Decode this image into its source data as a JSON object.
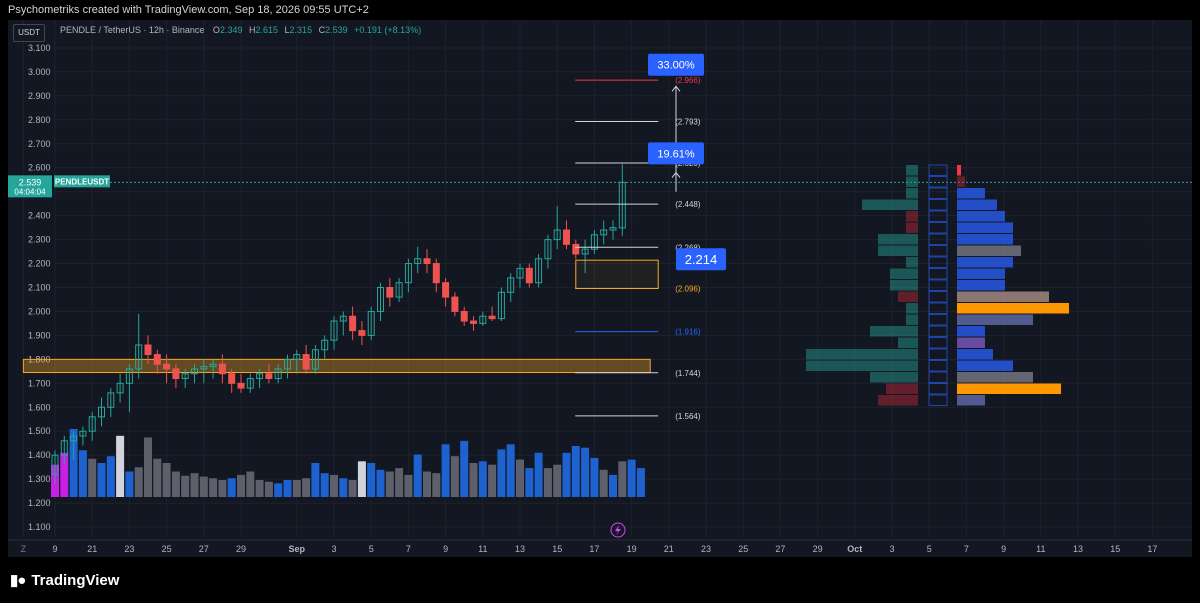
{
  "header": {
    "title": "Psychometriks created with TradingView.com, Sep 18, 2026 09:55 UTC+2"
  },
  "legend": {
    "symbol": "PENDLE / TetherUS · 12h · Binance",
    "open_label": "O",
    "open": "2.349",
    "high_label": "H",
    "high": "2.615",
    "low_label": "L",
    "low": "2.315",
    "close_label": "C",
    "close": "2.539",
    "change": "+0.191 (+8.13%)"
  },
  "currency_label": "USDT",
  "price_tag": {
    "price": "2.539",
    "countdown": "04:04:04",
    "ticker": "PENDLEUSDT"
  },
  "footer": {
    "logo_text": "TradingView"
  },
  "colors": {
    "up": "#26a69a",
    "down": "#ef5350",
    "grid": "#1e222d",
    "text": "#b2b5be",
    "volume_blue": "#1e62d0",
    "volume_gray": "#5d606b",
    "volume_white": "#d1d4dc",
    "volume_magenta": "#c81ee6",
    "zone_orange": "#f9a825",
    "label_blue": "#2962ff"
  },
  "chart_data": {
    "type": "candlestick",
    "y_ticks": [
      "3.100",
      "3.000",
      "2.900",
      "2.800",
      "2.700",
      "2.600",
      "2.500",
      "2.400",
      "2.300",
      "2.200",
      "2.100",
      "2.000",
      "1.900",
      "1.800",
      "1.700",
      "1.600",
      "1.500",
      "1.400",
      "1.300",
      "1.200",
      "1.100"
    ],
    "ylim": [
      1.05,
      3.15
    ],
    "x_ticks": [
      {
        "label": "Z",
        "day": 17.3
      },
      {
        "label": "9",
        "day": 19
      },
      {
        "label": "21",
        "day": 21
      },
      {
        "label": "23",
        "day": 23
      },
      {
        "label": "25",
        "day": 25
      },
      {
        "label": "27",
        "day": 27
      },
      {
        "label": "29",
        "day": 29
      },
      {
        "label": "Sep",
        "day": 32
      },
      {
        "label": "3",
        "day": 34
      },
      {
        "label": "5",
        "day": 36
      },
      {
        "label": "7",
        "day": 38
      },
      {
        "label": "9",
        "day": 40
      },
      {
        "label": "11",
        "day": 42
      },
      {
        "label": "13",
        "day": 44
      },
      {
        "label": "15",
        "day": 46
      },
      {
        "label": "17",
        "day": 48
      },
      {
        "label": "19",
        "day": 50
      },
      {
        "label": "21",
        "day": 52
      },
      {
        "label": "23",
        "day": 54
      },
      {
        "label": "25",
        "day": 56
      },
      {
        "label": "27",
        "day": 58
      },
      {
        "label": "29",
        "day": 60
      },
      {
        "label": "Oct",
        "day": 62
      },
      {
        "label": "3",
        "day": 64
      },
      {
        "label": "5",
        "day": 66
      },
      {
        "label": "7",
        "day": 68
      },
      {
        "label": "9",
        "day": 70
      },
      {
        "label": "11",
        "day": 72
      },
      {
        "label": "13",
        "day": 74
      },
      {
        "label": "15",
        "day": 76
      },
      {
        "label": "17",
        "day": 78
      }
    ],
    "candles": [
      {
        "t": 19.0,
        "o": 1.32,
        "h": 1.42,
        "l": 1.28,
        "c": 1.4
      },
      {
        "t": 19.5,
        "o": 1.4,
        "h": 1.48,
        "l": 1.36,
        "c": 1.46
      },
      {
        "t": 20.0,
        "o": 1.46,
        "h": 1.5,
        "l": 1.38,
        "c": 1.48
      },
      {
        "t": 20.5,
        "o": 1.48,
        "h": 1.52,
        "l": 1.44,
        "c": 1.5
      },
      {
        "t": 21.0,
        "o": 1.5,
        "h": 1.58,
        "l": 1.46,
        "c": 1.56
      },
      {
        "t": 21.5,
        "o": 1.56,
        "h": 1.64,
        "l": 1.52,
        "c": 1.6
      },
      {
        "t": 22.0,
        "o": 1.6,
        "h": 1.68,
        "l": 1.56,
        "c": 1.66
      },
      {
        "t": 22.5,
        "o": 1.66,
        "h": 1.74,
        "l": 1.62,
        "c": 1.7
      },
      {
        "t": 23.0,
        "o": 1.7,
        "h": 1.78,
        "l": 1.58,
        "c": 1.76
      },
      {
        "t": 23.5,
        "o": 1.76,
        "h": 1.99,
        "l": 1.72,
        "c": 1.86
      },
      {
        "t": 24.0,
        "o": 1.86,
        "h": 1.9,
        "l": 1.78,
        "c": 1.82
      },
      {
        "t": 24.5,
        "o": 1.82,
        "h": 1.84,
        "l": 1.74,
        "c": 1.78
      },
      {
        "t": 25.0,
        "o": 1.78,
        "h": 1.82,
        "l": 1.7,
        "c": 1.76
      },
      {
        "t": 25.5,
        "o": 1.76,
        "h": 1.78,
        "l": 1.68,
        "c": 1.72
      },
      {
        "t": 26.0,
        "o": 1.72,
        "h": 1.76,
        "l": 1.68,
        "c": 1.74
      },
      {
        "t": 26.5,
        "o": 1.74,
        "h": 1.78,
        "l": 1.7,
        "c": 1.76
      },
      {
        "t": 27.0,
        "o": 1.76,
        "h": 1.8,
        "l": 1.7,
        "c": 1.77
      },
      {
        "t": 27.5,
        "o": 1.77,
        "h": 1.8,
        "l": 1.72,
        "c": 1.78
      },
      {
        "t": 28.0,
        "o": 1.78,
        "h": 1.82,
        "l": 1.7,
        "c": 1.74
      },
      {
        "t": 28.5,
        "o": 1.74,
        "h": 1.76,
        "l": 1.66,
        "c": 1.7
      },
      {
        "t": 29.0,
        "o": 1.7,
        "h": 1.74,
        "l": 1.66,
        "c": 1.68
      },
      {
        "t": 29.5,
        "o": 1.68,
        "h": 1.74,
        "l": 1.66,
        "c": 1.72
      },
      {
        "t": 30.0,
        "o": 1.72,
        "h": 1.76,
        "l": 1.68,
        "c": 1.74
      },
      {
        "t": 30.5,
        "o": 1.74,
        "h": 1.78,
        "l": 1.7,
        "c": 1.72
      },
      {
        "t": 31.0,
        "o": 1.72,
        "h": 1.78,
        "l": 1.7,
        "c": 1.76
      },
      {
        "t": 31.5,
        "o": 1.76,
        "h": 1.82,
        "l": 1.72,
        "c": 1.8
      },
      {
        "t": 32.0,
        "o": 1.8,
        "h": 1.84,
        "l": 1.74,
        "c": 1.82
      },
      {
        "t": 32.5,
        "o": 1.82,
        "h": 1.86,
        "l": 1.74,
        "c": 1.76
      },
      {
        "t": 33.0,
        "o": 1.76,
        "h": 1.86,
        "l": 1.74,
        "c": 1.84
      },
      {
        "t": 33.5,
        "o": 1.84,
        "h": 1.9,
        "l": 1.8,
        "c": 1.88
      },
      {
        "t": 34.0,
        "o": 1.88,
        "h": 1.98,
        "l": 1.84,
        "c": 1.96
      },
      {
        "t": 34.5,
        "o": 1.96,
        "h": 2.0,
        "l": 1.9,
        "c": 1.98
      },
      {
        "t": 35.0,
        "o": 1.98,
        "h": 2.02,
        "l": 1.88,
        "c": 1.92
      },
      {
        "t": 35.5,
        "o": 1.92,
        "h": 1.96,
        "l": 1.86,
        "c": 1.9
      },
      {
        "t": 36.0,
        "o": 1.9,
        "h": 2.02,
        "l": 1.88,
        "c": 2.0
      },
      {
        "t": 36.5,
        "o": 2.0,
        "h": 2.12,
        "l": 1.96,
        "c": 2.1
      },
      {
        "t": 37.0,
        "o": 2.1,
        "h": 2.14,
        "l": 2.02,
        "c": 2.06
      },
      {
        "t": 37.5,
        "o": 2.06,
        "h": 2.14,
        "l": 2.04,
        "c": 2.12
      },
      {
        "t": 38.0,
        "o": 2.12,
        "h": 2.22,
        "l": 2.08,
        "c": 2.2
      },
      {
        "t": 38.5,
        "o": 2.2,
        "h": 2.27,
        "l": 2.16,
        "c": 2.22
      },
      {
        "t": 39.0,
        "o": 2.22,
        "h": 2.26,
        "l": 2.16,
        "c": 2.2
      },
      {
        "t": 39.5,
        "o": 2.2,
        "h": 2.22,
        "l": 2.08,
        "c": 2.12
      },
      {
        "t": 40.0,
        "o": 2.12,
        "h": 2.14,
        "l": 2.02,
        "c": 2.06
      },
      {
        "t": 40.5,
        "o": 2.06,
        "h": 2.08,
        "l": 1.98,
        "c": 2.0
      },
      {
        "t": 41.0,
        "o": 2.0,
        "h": 2.02,
        "l": 1.94,
        "c": 1.96
      },
      {
        "t": 41.5,
        "o": 1.96,
        "h": 1.98,
        "l": 1.92,
        "c": 1.95
      },
      {
        "t": 42.0,
        "o": 1.95,
        "h": 2.0,
        "l": 1.94,
        "c": 1.98
      },
      {
        "t": 42.5,
        "o": 1.98,
        "h": 2.02,
        "l": 1.96,
        "c": 1.97
      },
      {
        "t": 43.0,
        "o": 1.97,
        "h": 2.1,
        "l": 1.96,
        "c": 2.08
      },
      {
        "t": 43.5,
        "o": 2.08,
        "h": 2.16,
        "l": 2.04,
        "c": 2.14
      },
      {
        "t": 44.0,
        "o": 2.14,
        "h": 2.2,
        "l": 2.1,
        "c": 2.18
      },
      {
        "t": 44.5,
        "o": 2.18,
        "h": 2.2,
        "l": 2.1,
        "c": 2.12
      },
      {
        "t": 45.0,
        "o": 2.12,
        "h": 2.24,
        "l": 2.1,
        "c": 2.22
      },
      {
        "t": 45.5,
        "o": 2.22,
        "h": 2.32,
        "l": 2.18,
        "c": 2.3
      },
      {
        "t": 46.0,
        "o": 2.3,
        "h": 2.44,
        "l": 2.26,
        "c": 2.34
      },
      {
        "t": 46.5,
        "o": 2.34,
        "h": 2.38,
        "l": 2.26,
        "c": 2.28
      },
      {
        "t": 47.0,
        "o": 2.28,
        "h": 2.3,
        "l": 2.22,
        "c": 2.24
      },
      {
        "t": 47.5,
        "o": 2.24,
        "h": 2.3,
        "l": 2.16,
        "c": 2.26
      },
      {
        "t": 48.0,
        "o": 2.26,
        "h": 2.34,
        "l": 2.24,
        "c": 2.32
      },
      {
        "t": 48.5,
        "o": 2.32,
        "h": 2.38,
        "l": 2.28,
        "c": 2.34
      },
      {
        "t": 49.0,
        "o": 2.34,
        "h": 2.38,
        "l": 2.3,
        "c": 2.35
      },
      {
        "t": 49.5,
        "o": 2.349,
        "h": 2.615,
        "l": 2.315,
        "c": 2.539
      }
    ],
    "volume": {
      "x_start": 19.0,
      "x_step": 0.5,
      "max": 100,
      "values": [
        38,
        52,
        80,
        55,
        45,
        40,
        48,
        72,
        30,
        35,
        70,
        45,
        40,
        30,
        25,
        28,
        24,
        22,
        20,
        22,
        26,
        30,
        20,
        18,
        16,
        20,
        20,
        22,
        40,
        28,
        26,
        22,
        20,
        42,
        40,
        32,
        30,
        34,
        26,
        50,
        30,
        28,
        62,
        48,
        66,
        40,
        42,
        38,
        56,
        62,
        44,
        34,
        52,
        34,
        38,
        52,
        60,
        58,
        46,
        32,
        26,
        42,
        44,
        34
      ],
      "colors": [
        "magenta",
        "magenta",
        "blue",
        "blue",
        "gray",
        "blue",
        "blue",
        "white",
        "blue",
        "gray",
        "gray",
        "gray",
        "gray",
        "gray",
        "gray",
        "gray",
        "gray",
        "gray",
        "gray",
        "blue",
        "gray",
        "gray",
        "gray",
        "gray",
        "blue",
        "blue",
        "gray",
        "gray",
        "blue",
        "blue",
        "gray",
        "blue",
        "gray",
        "white",
        "blue",
        "blue",
        "gray",
        "gray",
        "gray",
        "blue",
        "gray",
        "gray",
        "blue",
        "gray",
        "blue",
        "gray",
        "blue",
        "gray",
        "blue",
        "blue",
        "gray",
        "blue",
        "blue",
        "gray",
        "gray",
        "blue",
        "blue",
        "blue",
        "blue",
        "gray",
        "blue",
        "gray",
        "blue",
        "blue"
      ]
    },
    "levels": [
      {
        "price": 2.966,
        "label": "(2.966)",
        "color": "#f23645"
      },
      {
        "price": 2.793,
        "label": "(2.793)",
        "color": "#d1d4dc"
      },
      {
        "price": 2.62,
        "label": "(2.620)",
        "color": "#d1d4dc"
      },
      {
        "price": 2.448,
        "label": "(2.448)",
        "color": "#d1d4dc"
      },
      {
        "price": 2.268,
        "label": "(2.268)",
        "color": "#d1d4dc"
      },
      {
        "price": 2.096,
        "label": "(2.096)",
        "color": "#f9a825"
      },
      {
        "price": 1.916,
        "label": "(1.916)",
        "color": "#2962ff"
      },
      {
        "price": 1.744,
        "label": "(1.744)",
        "color": "#d1d4dc"
      },
      {
        "price": 1.564,
        "label": "(1.564)",
        "color": "#d1d4dc"
      }
    ],
    "levels_x_range": [
      46,
      51
    ],
    "support_zone": {
      "y_low": 1.745,
      "y_high": 1.8,
      "x_start": 17.3,
      "x_end": 51
    },
    "entry_box": {
      "y_low": 2.096,
      "y_high": 2.214,
      "x_start": 47,
      "x_end": 51
    },
    "entry_label": "2.214",
    "targets": [
      {
        "label": "33.00%",
        "price": 3.03
      },
      {
        "label": "19.61%",
        "price": 2.66
      }
    ],
    "last_price": 2.539,
    "volume_profile": {
      "rows": [
        2.52,
        2.44,
        2.36,
        2.28,
        2.2,
        2.14,
        2.08,
        2.0,
        1.94,
        1.88,
        1.82,
        1.76,
        1.7,
        1.62,
        1.56,
        1.5,
        1.44,
        1.38,
        1.32,
        1.26
      ],
      "left": [
        {
          "v": 3,
          "c": "teal"
        },
        {
          "v": 3,
          "c": "teal"
        },
        {
          "v": 3,
          "c": "teal"
        },
        {
          "v": 14,
          "c": "teal"
        },
        {
          "v": 3,
          "c": "maroon"
        },
        {
          "v": 3,
          "c": "maroon"
        },
        {
          "v": 10,
          "c": "teal"
        },
        {
          "v": 10,
          "c": "teal"
        },
        {
          "v": 3,
          "c": "teal"
        },
        {
          "v": 7,
          "c": "teal"
        },
        {
          "v": 7,
          "c": "teal"
        },
        {
          "v": 5,
          "c": "maroon"
        },
        {
          "v": 3,
          "c": "teal"
        },
        {
          "v": 3,
          "c": "teal"
        },
        {
          "v": 12,
          "c": "teal"
        },
        {
          "v": 5,
          "c": "teal"
        },
        {
          "v": 28,
          "c": "teal"
        },
        {
          "v": 28,
          "c": "teal"
        },
        {
          "v": 12,
          "c": "teal"
        },
        {
          "v": 8,
          "c": "maroon"
        },
        {
          "v": 10,
          "c": "maroon"
        }
      ],
      "right": [
        {
          "v": 1,
          "c": "red"
        },
        {
          "v": 2,
          "c": "maroon"
        },
        {
          "v": 7,
          "c": "blue"
        },
        {
          "v": 10,
          "c": "blue"
        },
        {
          "v": 12,
          "c": "blue"
        },
        {
          "v": 14,
          "c": "blue"
        },
        {
          "v": 14,
          "c": "blue"
        },
        {
          "v": 16,
          "c": "gray"
        },
        {
          "v": 14,
          "c": "blue"
        },
        {
          "v": 12,
          "c": "blue"
        },
        {
          "v": 12,
          "c": "blue"
        },
        {
          "v": 23,
          "c": "brown"
        },
        {
          "v": 28,
          "c": "orange"
        },
        {
          "v": 19,
          "c": "slate"
        },
        {
          "v": 7,
          "c": "blue"
        },
        {
          "v": 7,
          "c": "purple"
        },
        {
          "v": 9,
          "c": "blue"
        },
        {
          "v": 14,
          "c": "blue"
        },
        {
          "v": 19,
          "c": "gray"
        },
        {
          "v": 26,
          "c": "orange"
        },
        {
          "v": 7,
          "c": "slate"
        }
      ]
    }
  }
}
